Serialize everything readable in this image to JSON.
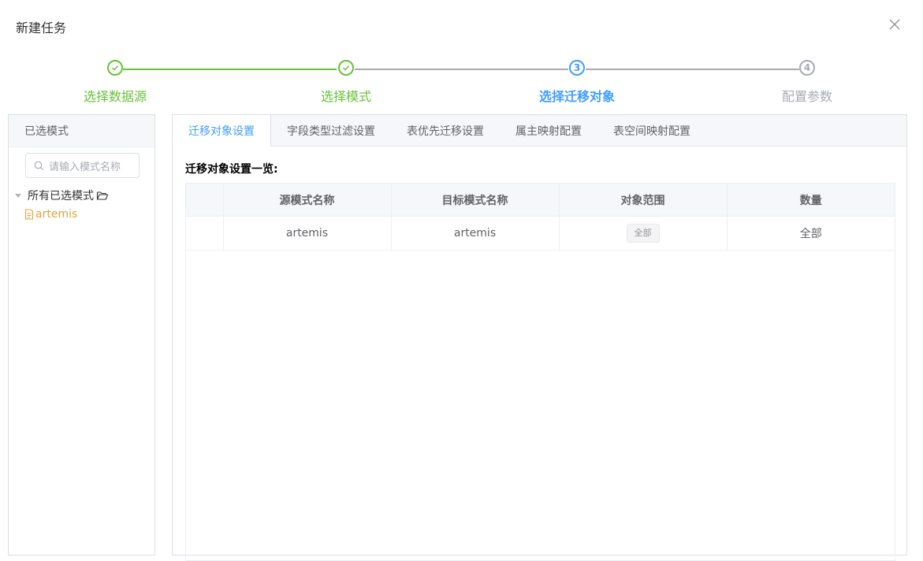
{
  "dialog": {
    "title": "新建任务"
  },
  "steps": [
    {
      "label": "选择数据源",
      "status": "done"
    },
    {
      "label": "选择模式",
      "status": "done"
    },
    {
      "label": "选择迁移对象",
      "status": "active",
      "number": "3"
    },
    {
      "label": "配置参数",
      "status": "wait",
      "number": "4"
    }
  ],
  "left_panel": {
    "header": "已选模式",
    "search_placeholder": "请输入模式名称",
    "tree": {
      "root_label": "所有已选模式",
      "children": [
        "artemis"
      ]
    }
  },
  "tabs": [
    {
      "label": "迁移对象设置",
      "active": true
    },
    {
      "label": "字段类型过滤设置",
      "active": false
    },
    {
      "label": "表优先迁移设置",
      "active": false
    },
    {
      "label": "属主映射配置",
      "active": false
    },
    {
      "label": "表空间映射配置",
      "active": false
    }
  ],
  "section_title": "迁移对象设置一览:",
  "table": {
    "columns": [
      "",
      "源模式名称",
      "目标模式名称",
      "对象范围",
      "数量"
    ],
    "rows": [
      {
        "source": "artemis",
        "target": "artemis",
        "scope": "全部",
        "count": "全部"
      }
    ]
  },
  "colors": {
    "done": "#67c23a",
    "active": "#409eff",
    "wait": "#a8abb2",
    "file": "#e6a23c"
  }
}
